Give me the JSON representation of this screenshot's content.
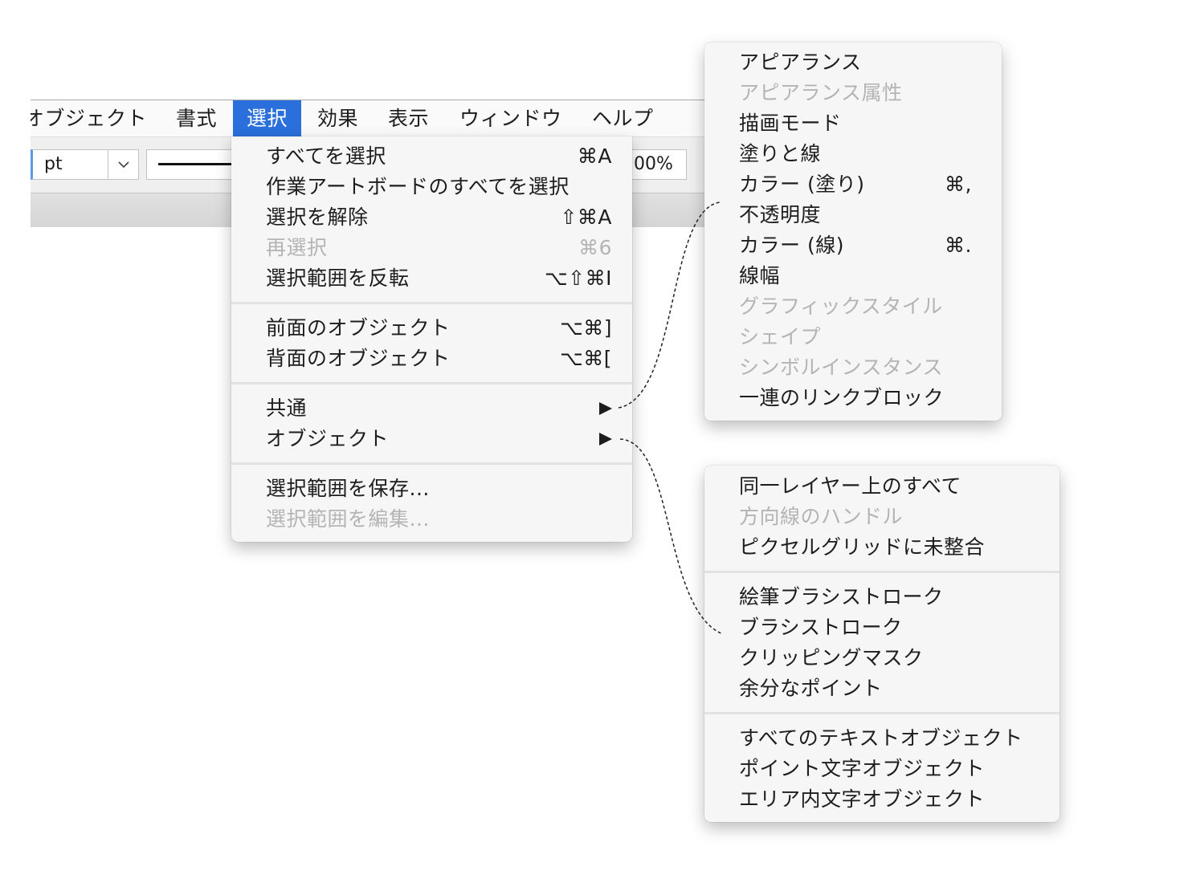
{
  "colors": {
    "accent": "#2a6fdb",
    "menu_bg": "#f6f6f6",
    "text": "#1d1d1d",
    "disabled_text": "#b4b4b4"
  },
  "icons": {
    "submenu_indicator": "triangle-right-icon",
    "dropdown": "chevron-down-icon"
  },
  "menubar": {
    "items": [
      {
        "label": "オブジェクト"
      },
      {
        "label": "書式"
      },
      {
        "label": "選択",
        "active": true
      },
      {
        "label": "効果"
      },
      {
        "label": "表示"
      },
      {
        "label": "ウィンドウ"
      },
      {
        "label": "ヘルプ"
      }
    ]
  },
  "toolbar": {
    "stroke_unit": "pt",
    "opacity_value": "00%"
  },
  "select_menu": {
    "items": [
      {
        "label": "すべてを選択",
        "shortcut": "⌘A"
      },
      {
        "label": "作業アートボードのすべてを選択"
      },
      {
        "label": "選択を解除",
        "shortcut": "⇧⌘A"
      },
      {
        "label": "再選択",
        "shortcut": "⌘6",
        "disabled": true
      },
      {
        "label": "選択範囲を反転",
        "shortcut": "⌥⇧⌘I"
      },
      {
        "label": "前面のオブジェクト",
        "shortcut": "⌥⌘]"
      },
      {
        "label": "背面のオブジェクト",
        "shortcut": "⌥⌘["
      },
      {
        "label": "共通",
        "submenu": true
      },
      {
        "label": "オブジェクト",
        "submenu": true
      },
      {
        "label": "選択範囲を保存..."
      },
      {
        "label": "選択範囲を編集...",
        "disabled": true
      }
    ]
  },
  "common_submenu": {
    "items": [
      {
        "label": "アピアランス"
      },
      {
        "label": "アピアランス属性",
        "disabled": true
      },
      {
        "label": "描画モード"
      },
      {
        "label": "塗りと線"
      },
      {
        "label": "カラー (塗り)",
        "shortcut": "⌘,"
      },
      {
        "label": "不透明度"
      },
      {
        "label": "カラー (線)",
        "shortcut": "⌘."
      },
      {
        "label": "線幅"
      },
      {
        "label": "グラフィックスタイル",
        "disabled": true
      },
      {
        "label": "シェイプ",
        "disabled": true
      },
      {
        "label": "シンボルインスタンス",
        "disabled": true
      },
      {
        "label": "一連のリンクブロック"
      }
    ]
  },
  "object_submenu": {
    "items": [
      {
        "label": "同一レイヤー上のすべて"
      },
      {
        "label": "方向線のハンドル",
        "disabled": true
      },
      {
        "label": "ピクセルグリッドに未整合"
      },
      {
        "label": "絵筆ブラシストローク"
      },
      {
        "label": "ブラシストローク"
      },
      {
        "label": "クリッピングマスク"
      },
      {
        "label": "余分なポイント"
      },
      {
        "label": "すべてのテキストオブジェクト"
      },
      {
        "label": "ポイント文字オブジェクト"
      },
      {
        "label": "エリア内文字オブジェクト"
      }
    ]
  }
}
